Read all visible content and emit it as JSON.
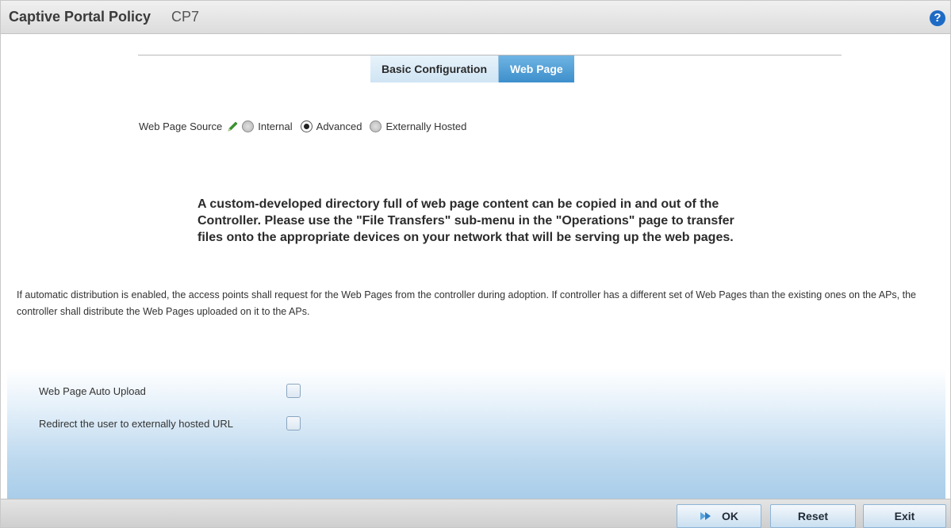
{
  "header": {
    "title": "Captive Portal Policy",
    "policy_name": "CP7",
    "help_icon": "help-icon",
    "help_glyph": "?"
  },
  "tabs": [
    {
      "label": "Basic Configuration",
      "active": false
    },
    {
      "label": "Web Page",
      "active": true
    }
  ],
  "web_page_source": {
    "label": "Web Page Source",
    "options": [
      {
        "label": "Internal",
        "selected": false
      },
      {
        "label": "Advanced",
        "selected": true
      },
      {
        "label": "Externally Hosted",
        "selected": false
      }
    ]
  },
  "notice_text": "A custom-developed directory full of web page content can be copied in and out of the Controller. Please use the \"File Transfers\" sub-menu in the \"Operations\" page to transfer files onto the appropriate devices on your network that will be serving up the web pages.",
  "info_text": "If automatic distribution is enabled, the access points shall request for the Web Pages from the controller during adoption. If controller has a different set of Web Pages than the existing ones on the APs, the controller shall distribute the Web Pages uploaded on it to the APs.",
  "options": {
    "auto_upload": {
      "label": "Web Page Auto Upload",
      "checked": false
    },
    "redirect": {
      "label": "Redirect the user to externally hosted URL",
      "checked": false
    }
  },
  "footer": {
    "ok_label": "OK",
    "reset_label": "Reset",
    "exit_label": "Exit"
  },
  "colors": {
    "accent_blue": "#3d8fcc",
    "help_blue": "#1e6bc6",
    "pencil_green": "#3a9a2e"
  }
}
